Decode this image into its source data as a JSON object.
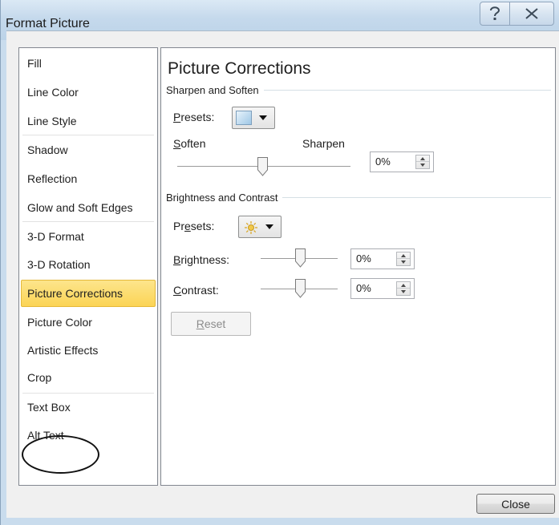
{
  "window": {
    "title": "Format Picture"
  },
  "categories": [
    {
      "label": "Fill"
    },
    {
      "label": "Line Color"
    },
    {
      "label": "Line Style"
    },
    {
      "label": "Shadow"
    },
    {
      "label": "Reflection"
    },
    {
      "label": "Glow and Soft Edges"
    },
    {
      "label": "3-D Format"
    },
    {
      "label": "3-D Rotation"
    },
    {
      "label": "Picture Corrections",
      "selected": true
    },
    {
      "label": "Picture Color"
    },
    {
      "label": "Artistic Effects"
    },
    {
      "label": "Crop"
    },
    {
      "label": "Text Box"
    },
    {
      "label": "Alt Text",
      "circled": true
    }
  ],
  "panel": {
    "title": "Picture Corrections",
    "sharpen": {
      "heading": "Sharpen and Soften",
      "presets_label_u": "P",
      "presets_label_rest": "resets:",
      "soften_label_u": "S",
      "soften_label_rest": "often",
      "sharpen_label": "Sharpen",
      "value": "0%"
    },
    "brightness": {
      "heading": "Brightness and Contrast",
      "presets_label_a": "Pr",
      "presets_label_u": "e",
      "presets_label_b": "sets:",
      "brightness_label_u": "B",
      "brightness_label_rest": "rightness:",
      "brightness_value": "0%",
      "contrast_label_u": "C",
      "contrast_label_rest": "ontrast:",
      "contrast_value": "0%"
    },
    "reset_u": "R",
    "reset_rest": "eset"
  },
  "footer": {
    "close_label": "Close"
  },
  "icons": {
    "help": "help-question-icon",
    "close": "close-x-icon",
    "sharpen_preset": "picture-thumbnail-icon",
    "brightness_preset": "sun-icon"
  }
}
